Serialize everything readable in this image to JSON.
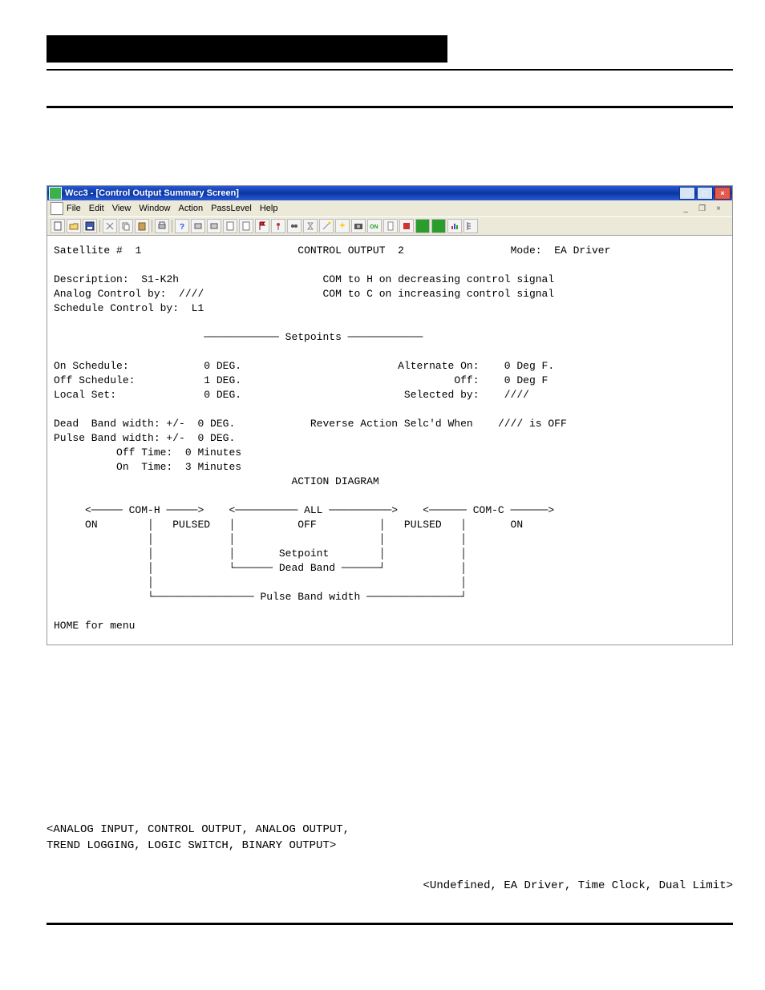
{
  "window": {
    "title": "Wcc3 - [Control Output Summary Screen]",
    "menus": {
      "file": "File",
      "edit": "Edit",
      "view": "View",
      "window": "Window",
      "action": "Action",
      "passlevel": "PassLevel",
      "help": "Help"
    }
  },
  "header": {
    "sat_label": "Satellite #",
    "sat_num": "1",
    "ctrl_label": "CONTROL OUTPUT",
    "ctrl_num": "2",
    "mode_label": "Mode:",
    "mode_val": "EA Driver"
  },
  "desc": {
    "desc_label": "Description:",
    "desc_val": "S1-K2h",
    "analog_label": "Analog Control by:",
    "analog_val": "////",
    "sched_label": "Schedule Control by:",
    "sched_val": "L1",
    "com_h": "COM to H on decreasing control signal",
    "com_c": "COM to C on increasing control signal"
  },
  "setpoints_title": "Setpoints",
  "sp": {
    "on_sched_l": "On Schedule:",
    "on_sched_v": "0 DEG.",
    "off_sched_l": "Off Schedule:",
    "off_sched_v": "1 DEG.",
    "local_set_l": "Local Set:",
    "local_set_v": "0 DEG.",
    "alt_on_l": "Alternate On:",
    "alt_on_v": "0 Deg F.",
    "off_l": "Off:",
    "off_v": "0 Deg F",
    "sel_by_l": "Selected by:",
    "sel_by_v": "////",
    "dead_l": "Dead  Band width: +/-",
    "dead_v": "0 DEG.",
    "pulse_l": "Pulse Band width: +/-",
    "pulse_v": "0 DEG.",
    "offtime_l": "Off Time:",
    "offtime_v": "0 Minutes",
    "ontime_l": "On  Time:",
    "ontime_v": "3 Minutes",
    "rev_l": "Reverse Action Selc'd When",
    "rev_v": "//// is OFF"
  },
  "diagram": {
    "title": "ACTION DIAGRAM",
    "comh": "COM-H",
    "all": "ALL",
    "comc": "COM-C",
    "on": "ON",
    "pulsed": "PULSED",
    "off": "OFF",
    "setpoint": "Setpoint",
    "deadband": "Dead Band",
    "pbw": "Pulse Band width"
  },
  "home": "HOME for menu",
  "notes": {
    "l1": "<ANALOG INPUT, CONTROL OUTPUT, ANALOG OUTPUT,",
    "l2": " TREND LOGGING, LOGIC SWITCH, BINARY OUTPUT>",
    "r1": "<Undefined, EA Driver, Time Clock, Dual Limit>"
  }
}
